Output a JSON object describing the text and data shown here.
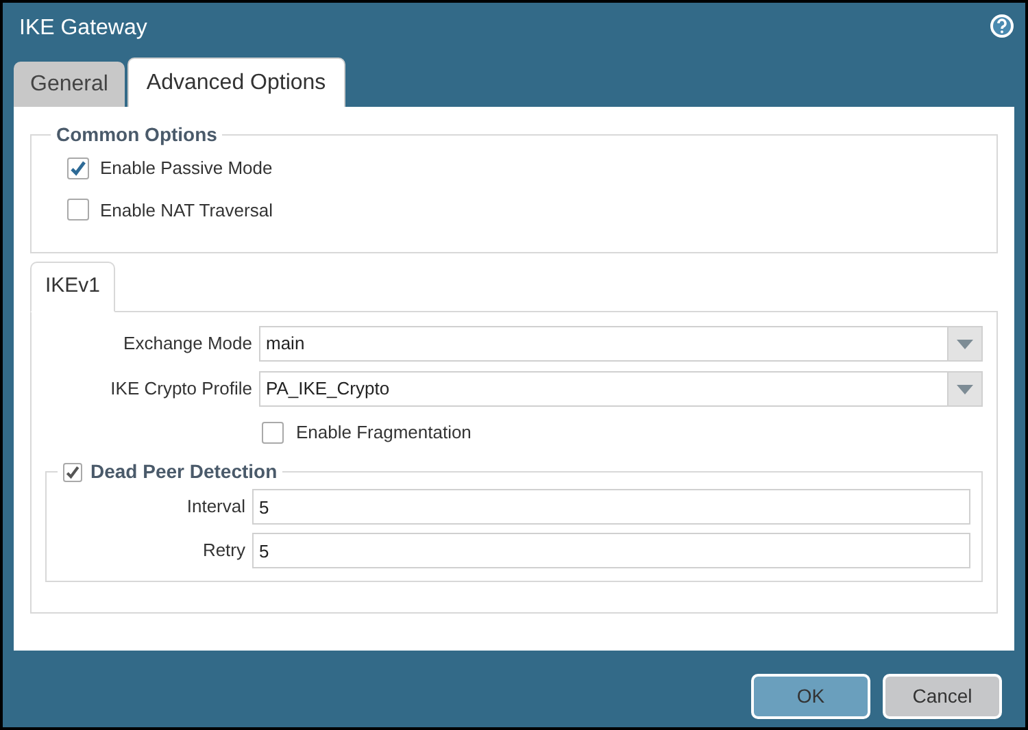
{
  "window": {
    "title": "IKE Gateway"
  },
  "tabs": [
    {
      "label": "General",
      "selected": false
    },
    {
      "label": "Advanced Options",
      "selected": true
    }
  ],
  "common_options": {
    "legend": "Common Options",
    "checkboxes": [
      {
        "label": "Enable Passive Mode",
        "checked": true
      },
      {
        "label": "Enable NAT Traversal",
        "checked": false
      }
    ]
  },
  "inner_tabs": [
    {
      "label": "IKEv1",
      "selected": true
    }
  ],
  "ikev1": {
    "fields": [
      {
        "label": "Exchange Mode",
        "value": "main"
      },
      {
        "label": "IKE Crypto Profile",
        "value": "PA_IKE_Crypto"
      }
    ],
    "fragmentation": {
      "label": "Enable Fragmentation",
      "checked": false
    },
    "dead_peer_detection": {
      "label": "Dead Peer Detection",
      "checked": true,
      "fields": [
        {
          "label": "Interval",
          "value": "5"
        },
        {
          "label": "Retry",
          "value": "5"
        }
      ]
    }
  },
  "buttons": [
    {
      "label": "OK",
      "kind": "primary"
    },
    {
      "label": "Cancel",
      "kind": "secondary"
    }
  ]
}
